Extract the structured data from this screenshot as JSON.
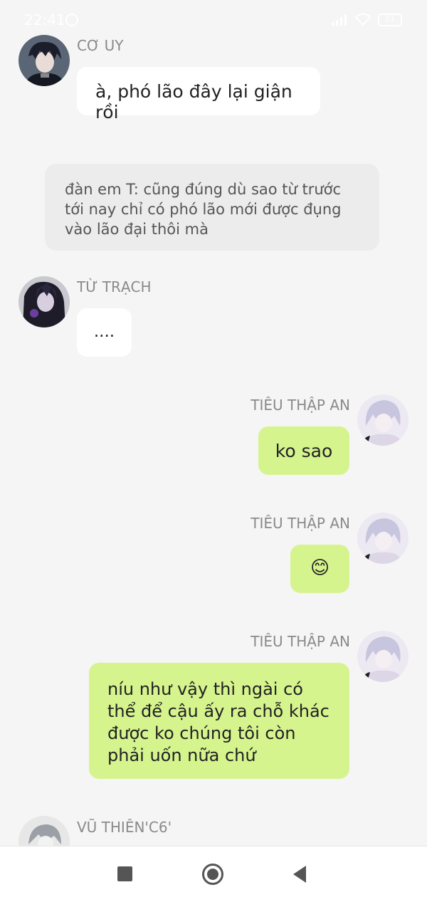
{
  "status_bar": {
    "time": "22:41",
    "battery": "21"
  },
  "messages": [
    {
      "sender": "CƠ UY",
      "text": "à, phó lão đây lại giận rồi",
      "side": "left",
      "avatar_icon": "avatar-dark-haired-man-icon"
    },
    {
      "sender": "TỪ TRẠCH",
      "text": "....",
      "side": "left",
      "avatar_icon": "avatar-dark-hooded-man-icon"
    },
    {
      "sender": "TIÊU THẬP AN",
      "text": "ko sao",
      "side": "right",
      "avatar_icon": "avatar-white-haired-boy-icon"
    },
    {
      "sender": "TIÊU THẬP AN",
      "text": "😊",
      "side": "right",
      "avatar_icon": "avatar-white-haired-boy-icon"
    },
    {
      "sender": "TIÊU THẬP AN",
      "text": "níu như vậy thì ngài có thể để cậu ấy ra chỗ khác được ko chúng tôi còn phải uốn nữa chứ",
      "side": "right",
      "avatar_icon": "avatar-white-haired-boy-icon"
    },
    {
      "sender": "VŨ THIÊN'C6'",
      "text": "",
      "side": "left",
      "avatar_icon": "avatar-grey-sketch-icon"
    }
  ],
  "system_note": {
    "text": "đàn em T: cũng đúng dù sao từ trước tới nay chỉ có phó lão mới được đụng vào lão đại thôi mà"
  },
  "nav_bar": {
    "recent_icon": "square-icon",
    "home_icon": "circle-icon",
    "back_icon": "triangle-back-icon"
  },
  "colors": {
    "background": "#f5f5f5",
    "bubble_white": "#ffffff",
    "bubble_green": "#d6f48e",
    "system_note": "#ececec",
    "sender_text": "#8a8a8a"
  }
}
